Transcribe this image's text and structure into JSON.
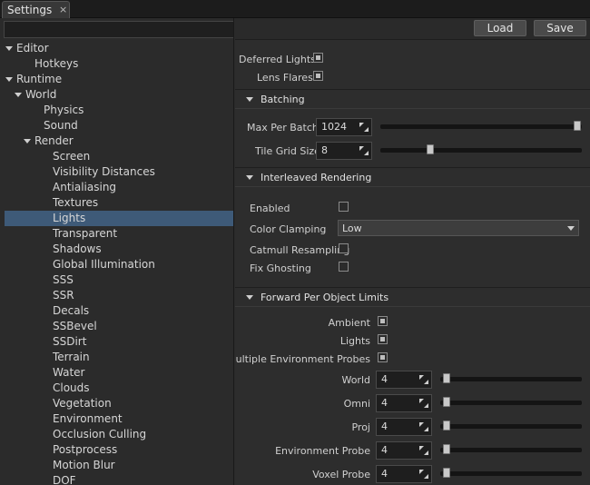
{
  "tab": {
    "title": "Settings",
    "close": "×"
  },
  "search": {
    "value": "",
    "placeholder": ""
  },
  "tree": [
    {
      "label": "Editor",
      "depth": 0,
      "expanded": true
    },
    {
      "label": "Hotkeys",
      "depth": 1,
      "expanded": null
    },
    {
      "label": "Runtime",
      "depth": 0,
      "expanded": true
    },
    {
      "label": "World",
      "depth": 1,
      "expanded": true
    },
    {
      "label": "Physics",
      "depth": 2,
      "expanded": null
    },
    {
      "label": "Sound",
      "depth": 2,
      "expanded": null
    },
    {
      "label": "Render",
      "depth": 2,
      "expanded": true
    },
    {
      "label": "Screen",
      "depth": 3,
      "expanded": null
    },
    {
      "label": "Visibility Distances",
      "depth": 3,
      "expanded": null
    },
    {
      "label": "Antialiasing",
      "depth": 3,
      "expanded": null
    },
    {
      "label": "Textures",
      "depth": 3,
      "expanded": null
    },
    {
      "label": "Lights",
      "depth": 3,
      "expanded": null,
      "selected": true
    },
    {
      "label": "Transparent",
      "depth": 3,
      "expanded": null
    },
    {
      "label": "Shadows",
      "depth": 3,
      "expanded": null
    },
    {
      "label": "Global Illumination",
      "depth": 3,
      "expanded": null
    },
    {
      "label": "SSS",
      "depth": 3,
      "expanded": null
    },
    {
      "label": "SSR",
      "depth": 3,
      "expanded": null
    },
    {
      "label": "Decals",
      "depth": 3,
      "expanded": null
    },
    {
      "label": "SSBevel",
      "depth": 3,
      "expanded": null
    },
    {
      "label": "SSDirt",
      "depth": 3,
      "expanded": null
    },
    {
      "label": "Terrain",
      "depth": 3,
      "expanded": null
    },
    {
      "label": "Water",
      "depth": 3,
      "expanded": null
    },
    {
      "label": "Clouds",
      "depth": 3,
      "expanded": null
    },
    {
      "label": "Vegetation",
      "depth": 3,
      "expanded": null
    },
    {
      "label": "Environment",
      "depth": 3,
      "expanded": null
    },
    {
      "label": "Occlusion Culling",
      "depth": 3,
      "expanded": null
    },
    {
      "label": "Postprocess",
      "depth": 3,
      "expanded": null
    },
    {
      "label": "Motion Blur",
      "depth": 3,
      "expanded": null
    },
    {
      "label": "DOF",
      "depth": 3,
      "expanded": null
    }
  ],
  "toolbar": {
    "load_label": "Load",
    "save_label": "Save"
  },
  "general": {
    "deferred_lights": {
      "label": "Deferred Lights",
      "checked": true
    },
    "lens_flares": {
      "label": "Lens Flares",
      "checked": true
    }
  },
  "batching": {
    "title": "Batching",
    "max_per_batch": {
      "label": "Max Per Batch",
      "value": "1024",
      "fraction": 1.0
    },
    "tile_grid_size": {
      "label": "Tile Grid Size",
      "value": "8",
      "fraction": 0.24
    }
  },
  "interleaved": {
    "title": "Interleaved Rendering",
    "enabled": {
      "label": "Enabled",
      "checked": false
    },
    "color_clamping": {
      "label": "Color Clamping",
      "value": "Low"
    },
    "catmull": {
      "label": "Catmull Resampling",
      "checked": false
    },
    "fix_ghosting": {
      "label": "Fix Ghosting",
      "checked": false
    }
  },
  "forward": {
    "title": "Forward Per Object Limits",
    "ambient": {
      "label": "Ambient",
      "checked": true
    },
    "lights": {
      "label": "Lights",
      "checked": true
    },
    "multi_env": {
      "label": "Multiple Environment Probes",
      "checked": true
    },
    "world": {
      "label": "World",
      "value": "4",
      "fraction": 0.02
    },
    "omni": {
      "label": "Omni",
      "value": "4",
      "fraction": 0.02
    },
    "proj": {
      "label": "Proj",
      "value": "4",
      "fraction": 0.02
    },
    "env_probe": {
      "label": "Environment Probe",
      "value": "4",
      "fraction": 0.02
    },
    "voxel_probe": {
      "label": "Voxel Probe",
      "value": "4",
      "fraction": 0.02
    }
  }
}
